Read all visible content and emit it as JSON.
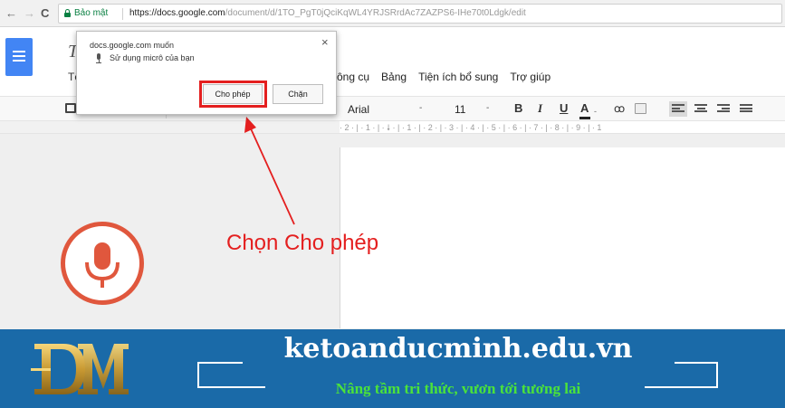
{
  "browser": {
    "nav": {
      "back": "←",
      "forward": "→",
      "reload": "C"
    },
    "secure_label": "Bảo mật",
    "url_host": "https://docs.google.com",
    "url_path": "/document/d/1TO_PgT0jQciKqWL4YRJSRrdAc7ZAZPS6-IHe70t0Ldgk/edit"
  },
  "docs": {
    "title_partial": "T:",
    "subtitle_partial": "Tệ",
    "menu": [
      "ông cụ",
      "Bảng",
      "Tiện ích bổ sung",
      "Trợ giúp"
    ],
    "toolbar": {
      "font": "Arial",
      "font_arrow": "-",
      "size": "11",
      "size_arrow": "-",
      "bold": "B",
      "italic": "I",
      "underline": "U",
      "text_color": "A",
      "color_arrow": "-",
      "link": "ꝏ"
    },
    "ruler": "· 2 · | · 1 · | · 🠗 · | · 1 · | · 2 · | · 3 · | · 4 · | · 5 · | · 6 · | · 7 · | · 8 · | · 9 · | · 1"
  },
  "popup": {
    "title": "docs.google.com muốn",
    "close": "×",
    "message": "Sử dụng micrô của bạn",
    "allow_label": "Cho phép",
    "block_label": "Chặn"
  },
  "annotation": {
    "text": "Chọn Cho phép",
    "color": "#e41f1f"
  },
  "banner": {
    "site": "ketoanducminh.edu.vn",
    "tagline": "Nâng tầm tri thức, vươn tới tương lai",
    "background": "#1a6aa8",
    "tagline_color": "#4be33a"
  },
  "colors": {
    "docs_blue": "#4285f4",
    "mic_orange": "#e0573d",
    "secure_green": "#0b8043"
  }
}
